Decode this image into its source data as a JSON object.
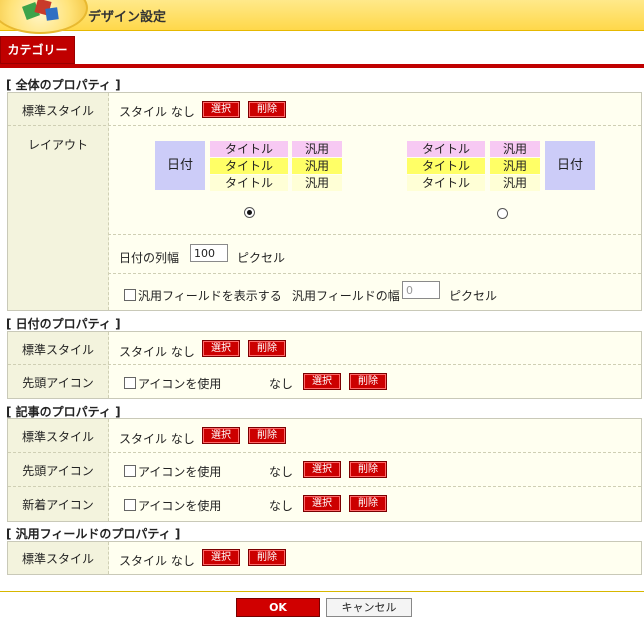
{
  "window": {
    "title": "デザイン設定"
  },
  "tab": {
    "label": "カテゴリー"
  },
  "sections": {
    "overall": {
      "title": "[ 全体のプロパティ ]",
      "standard_style_label": "標準スタイル",
      "style_value": "スタイル なし",
      "layout_label": "レイアウト",
      "layout_left": {
        "date": "日付",
        "titles": [
          "タイトル",
          "タイトル",
          "タイトル"
        ],
        "generals": [
          "汎用",
          "汎用",
          "汎用"
        ]
      },
      "layout_right": {
        "date": "日付",
        "titles": [
          "タイトル",
          "タイトル",
          "タイトル"
        ],
        "generals": [
          "汎用",
          "汎用",
          "汎用"
        ]
      },
      "date_width_label": "日付の列幅",
      "date_width_value": "100",
      "pixel_label": "ピクセル",
      "show_general_label": "汎用フィールドを表示する",
      "general_width_label": "汎用フィールドの幅",
      "general_width_value": "0",
      "pixel_label2": "ピクセル"
    },
    "date": {
      "title": "[ 日付のプロパティ ]",
      "standard_style_label": "標準スタイル",
      "style_value": "スタイル なし",
      "lead_icon_label": "先頭アイコン",
      "use_icon_label": "アイコンを使用",
      "icon_value": "なし"
    },
    "article": {
      "title": "[ 記事のプロパティ ]",
      "standard_style_label": "標準スタイル",
      "style_value": "スタイル なし",
      "lead_icon_label": "先頭アイコン",
      "use_icon_label": "アイコンを使用",
      "icon_value": "なし",
      "new_icon_label": "新着アイコン",
      "use_icon_label2": "アイコンを使用",
      "icon_value2": "なし"
    },
    "general": {
      "title": "[ 汎用フィールドのプロパティ ]",
      "standard_style_label": "標準スタイル",
      "style_value": "スタイル なし"
    }
  },
  "buttons": {
    "select": "選択",
    "delete": "削除",
    "ok": "OK",
    "cancel": "キャンセル"
  },
  "layout_choice": {
    "selected": "left"
  }
}
